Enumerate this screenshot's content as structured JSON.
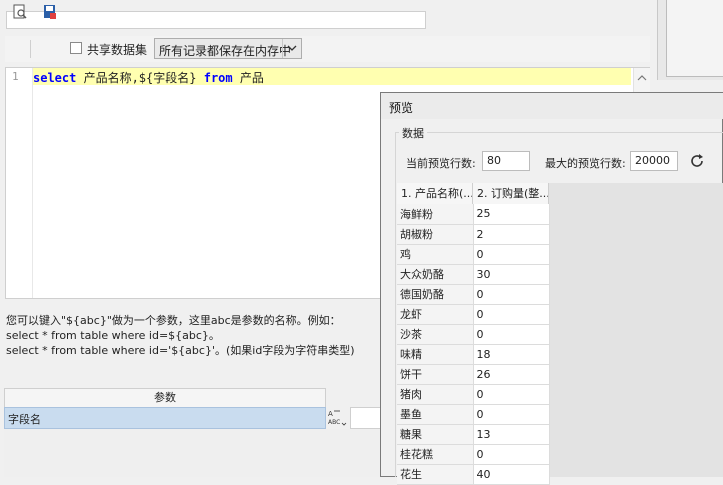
{
  "toolbar": {
    "share_label": "共享数据集",
    "storage_mode": "所有记录都保存在内存中"
  },
  "editor": {
    "line_number": "1",
    "code": {
      "kw_select": "select",
      "fields": " 产品名称,${字段名} ",
      "kw_from": "from",
      "table": " 产品"
    }
  },
  "help_text": "您可以键入\"${abc}\"做为一个参数，这里abc是参数的名称。例如：\nselect * from table where id=${abc}。\nselect * from table where id='${abc}'。(如果id字段为字符串类型)",
  "params": {
    "header": "参数",
    "rows": [
      "字段名"
    ],
    "type_icon": "ABC"
  },
  "preview": {
    "title": "预览",
    "group_label": "数据",
    "current_rows_label": "当前预览行数:",
    "current_rows_value": "80",
    "max_rows_label": "最大的预览行数:",
    "max_rows_value": "20000",
    "columns": [
      "1. 产品名称(...",
      "2. 订购量(整..."
    ],
    "rows": [
      [
        "海鲜粉",
        "25"
      ],
      [
        "胡椒粉",
        "2"
      ],
      [
        "鸡",
        "0"
      ],
      [
        "大众奶酪",
        "30"
      ],
      [
        "德国奶酪",
        "0"
      ],
      [
        "龙虾",
        "0"
      ],
      [
        "沙茶",
        "0"
      ],
      [
        "味精",
        "18"
      ],
      [
        "饼干",
        "26"
      ],
      [
        "猪肉",
        "0"
      ],
      [
        "墨鱼",
        "0"
      ],
      [
        "糖果",
        "13"
      ],
      [
        "桂花糕",
        "0"
      ],
      [
        "花生",
        "40"
      ]
    ]
  },
  "colors": {
    "highlight_line": "#ffffb0",
    "keyword": "#0000ff",
    "param_selected": "#c9dcef"
  }
}
